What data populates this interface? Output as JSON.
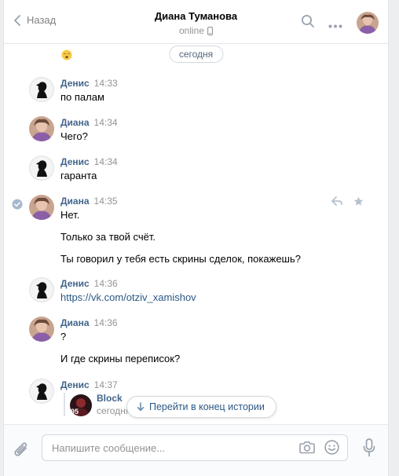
{
  "header": {
    "back_label": "Назад",
    "title": "Диана Туманова",
    "status": "online",
    "device_icon": "mobile-icon",
    "colors": {
      "muted": "#828282",
      "link": "#2a5885",
      "author": "#42648b"
    }
  },
  "history": {
    "day_label": "сегодня",
    "top_emoji": "🥱",
    "messages": [
      {
        "author": "Денис",
        "time": "14:33",
        "lines": [
          "по палам"
        ]
      },
      {
        "author": "Диана",
        "time": "14:34",
        "lines": [
          "Чего?"
        ]
      },
      {
        "author": "Денис",
        "time": "14:34",
        "lines": [
          "гаранта"
        ]
      },
      {
        "author": "Диана",
        "time": "14:35",
        "lines": [
          "Нет.",
          "Только за твой счёт.",
          "Ты говорил у тебя есть скрины сделок, покажешь?"
        ]
      },
      {
        "author": "Денис",
        "time": "14:36",
        "link": "https://vk.com/otziv_xamishov"
      },
      {
        "author": "Диана",
        "time": "14:36",
        "lines": [
          "?",
          "И где скрины переписок?"
        ]
      },
      {
        "author": "Денис",
        "time": "14:37",
        "forwarded": {
          "name": "Block",
          "date": "сегодня в",
          "badge": "95"
        }
      }
    ],
    "jump_label": "Перейти в конец истории"
  },
  "composer": {
    "placeholder": "Напишите сообщение..."
  }
}
